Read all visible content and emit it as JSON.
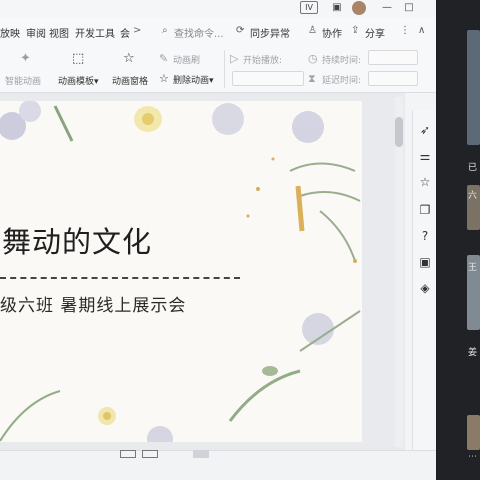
{
  "titlebar": {
    "user_badge": "IV",
    "controls": [
      "▣",
      "⋮",
      "—",
      "□"
    ]
  },
  "menubar": {
    "items": [
      "放映",
      "审阅",
      "视图",
      "开发工具",
      "会"
    ],
    "more_arrow": ">",
    "search_placeholder": "查找命令...",
    "sync_label": "同步异常",
    "collab_label": "协作",
    "share_label": "分享",
    "more_icon": "⋮",
    "collapse_icon": "∧"
  },
  "ribbon": {
    "smart_animation_label": "智能动画",
    "animation_template_label": "动画模板",
    "animation_template_arrow": "▾",
    "animation_pane_label": "动画窗格",
    "animation_brush_label": "动画刷",
    "delete_animation_label": "删除动画",
    "delete_animation_arrow": "▾",
    "start_play_label": "开始播放:",
    "duration_label": "持续时间:",
    "delay_label": "延迟时间:"
  },
  "slide": {
    "title": "舞动的文化",
    "subtitle": "级六班   暑期线上展示会"
  },
  "meeting_panel": {
    "labels": [
      "已",
      "六",
      "王",
      "姜"
    ]
  },
  "colors": {
    "background": "#1b1d20",
    "app_bg": "#f3f4f6",
    "slide_bg": "#fbf9f5",
    "accent_blue": "#3a6fd8"
  }
}
